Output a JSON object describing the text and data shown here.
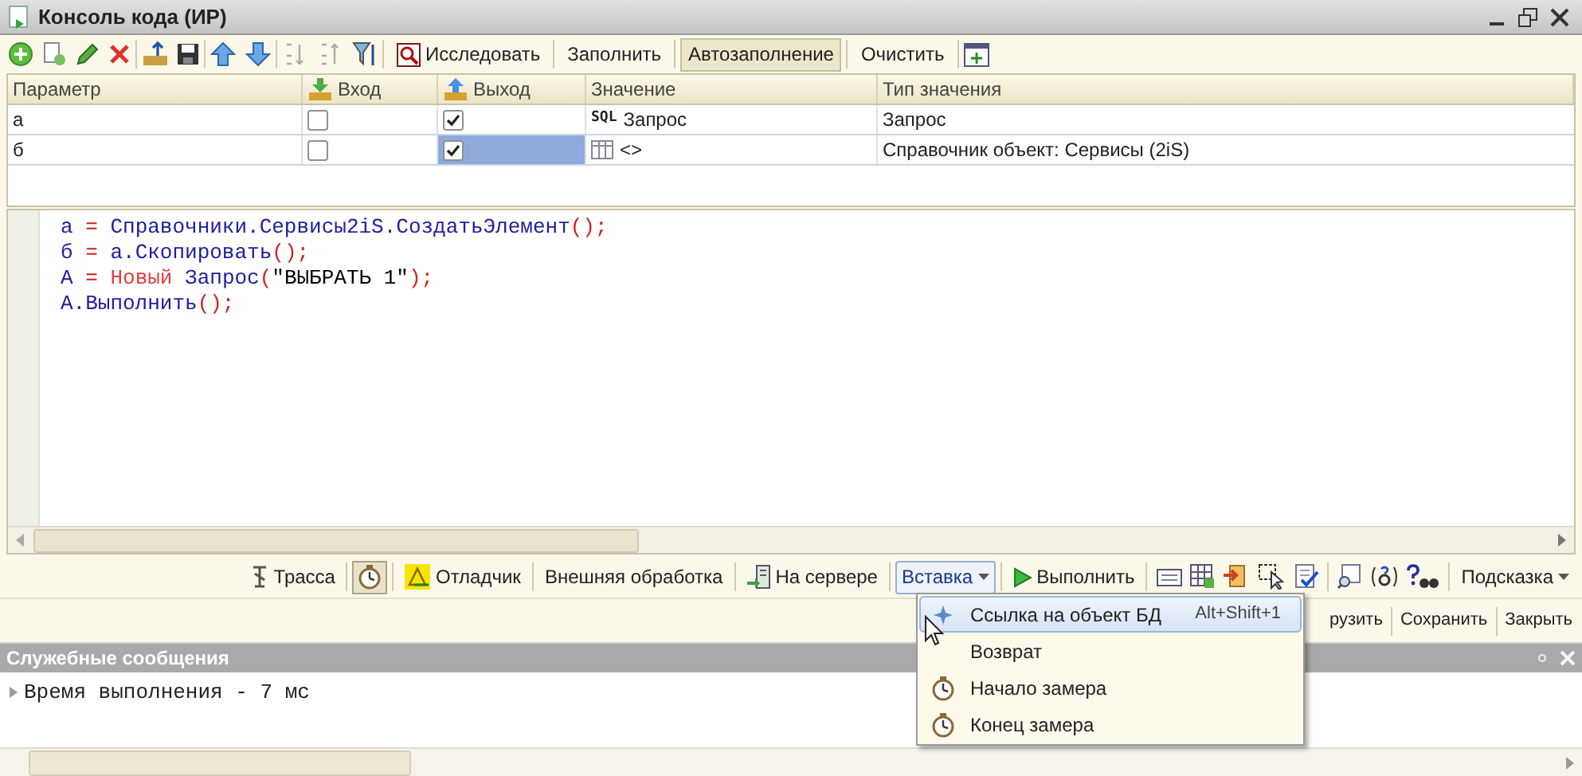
{
  "window": {
    "title": "Консоль кода (ИР)"
  },
  "toolbar": {
    "buttons": [
      {
        "label": "Исследовать",
        "pressed": false
      },
      {
        "label": "Заполнить",
        "pressed": false
      },
      {
        "label": "Автозаполнение",
        "pressed": true
      },
      {
        "label": "Очистить",
        "pressed": false
      }
    ]
  },
  "table": {
    "columns": [
      {
        "label": "Параметр"
      },
      {
        "label": "Вход"
      },
      {
        "label": "Выход"
      },
      {
        "label": "Значение"
      },
      {
        "label": "Тип значения"
      }
    ],
    "rows": [
      {
        "name": "а",
        "in_checked": false,
        "out_checked": true,
        "kind": "query",
        "value_badge": "SQL",
        "value": "Запрос",
        "type": "Запрос",
        "selected": false
      },
      {
        "name": "б",
        "in_checked": false,
        "out_checked": true,
        "kind": "object",
        "value": "<>",
        "type": "Справочник объект: Сервисы (2iS)",
        "selected": true
      }
    ]
  },
  "code": [
    [
      {
        "kind": "ident",
        "text": "а"
      },
      {
        "kind": "op",
        "text": " = "
      },
      {
        "kind": "ident",
        "text": "Справочники.Сервисы2iS.СоздатьЭлемент"
      },
      {
        "kind": "op",
        "text": "();"
      }
    ],
    [
      {
        "kind": "ident",
        "text": "б"
      },
      {
        "kind": "op",
        "text": " = "
      },
      {
        "kind": "ident",
        "text": "а.Скопировать"
      },
      {
        "kind": "op",
        "text": "();"
      }
    ],
    [
      {
        "kind": "ident",
        "text": "А"
      },
      {
        "kind": "op",
        "text": " = "
      },
      {
        "kind": "keyword",
        "text": "Новый"
      },
      {
        "kind": "ident",
        "text": " Запрос"
      },
      {
        "kind": "op",
        "text": "("
      },
      {
        "kind": "string",
        "text": "\"ВЫБРАТЬ 1\""
      },
      {
        "kind": "op",
        "text": ");"
      }
    ],
    [
      {
        "kind": "ident",
        "text": "А.Выполнить"
      },
      {
        "kind": "op",
        "text": "();"
      }
    ]
  ],
  "bottom_toolbar": {
    "items": [
      {
        "kind": "button",
        "label": "Трасса",
        "pressed": false
      },
      {
        "kind": "toggle",
        "pressed": true
      },
      {
        "kind": "button",
        "label": "Отладчик",
        "pressed": false
      },
      {
        "kind": "button",
        "label": "Внешняя обработка",
        "pressed": false
      },
      {
        "kind": "button",
        "label": "На сервере",
        "pressed": false
      },
      {
        "kind": "dropdown",
        "label": "Вставка",
        "pressed": true
      },
      {
        "kind": "button",
        "label": "Выполнить",
        "pressed": false
      },
      {
        "kind": "icons"
      },
      {
        "kind": "dropdown",
        "label": "Подсказка",
        "pressed": false
      }
    ]
  },
  "form_buttons": [
    {
      "label": "рузить"
    },
    {
      "label": "Сохранить"
    },
    {
      "label": "Закрыть"
    }
  ],
  "insert_menu": {
    "items": [
      {
        "label": "Ссылка на объект БД",
        "shortcut": "Alt+Shift+1",
        "selected": true
      },
      {
        "label": "Возврат",
        "selected": false
      },
      {
        "label": "Начало замера",
        "selected": false
      },
      {
        "label": "Конец замера",
        "selected": false
      }
    ]
  },
  "messages_panel": {
    "title": "Служебные сообщения",
    "messages": [
      "Время выполнения - 7 мс"
    ]
  }
}
